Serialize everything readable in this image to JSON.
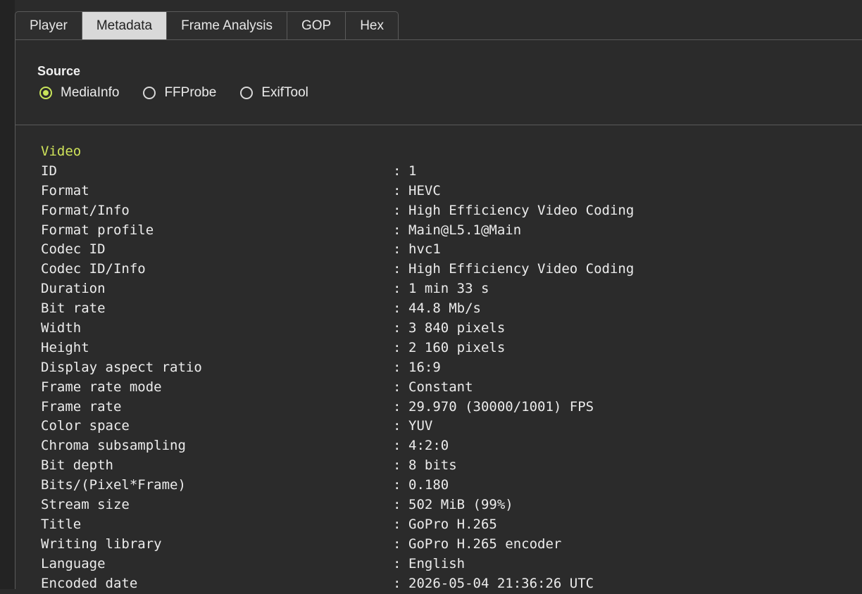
{
  "tabs": [
    {
      "label": "Player",
      "active": false
    },
    {
      "label": "Metadata",
      "active": true
    },
    {
      "label": "Frame Analysis",
      "active": false
    },
    {
      "label": "GOP",
      "active": false
    },
    {
      "label": "Hex",
      "active": false
    }
  ],
  "source": {
    "title": "Source",
    "options": [
      {
        "label": "MediaInfo",
        "checked": true
      },
      {
        "label": "FFProbe",
        "checked": false
      },
      {
        "label": "ExifTool",
        "checked": false
      }
    ]
  },
  "separator": ":",
  "video": {
    "title": "Video",
    "rows": [
      {
        "key": "ID",
        "value": "1"
      },
      {
        "key": "Format",
        "value": "HEVC"
      },
      {
        "key": "Format/Info",
        "value": "High Efficiency Video Coding"
      },
      {
        "key": "Format profile",
        "value": "Main@L5.1@Main"
      },
      {
        "key": "Codec ID",
        "value": "hvc1"
      },
      {
        "key": "Codec ID/Info",
        "value": "High Efficiency Video Coding"
      },
      {
        "key": "Duration",
        "value": "1 min 33 s"
      },
      {
        "key": "Bit rate",
        "value": "44.8 Mb/s"
      },
      {
        "key": "Width",
        "value": "3 840 pixels"
      },
      {
        "key": "Height",
        "value": "2 160 pixels"
      },
      {
        "key": "Display aspect ratio",
        "value": "16:9"
      },
      {
        "key": "Frame rate mode",
        "value": "Constant"
      },
      {
        "key": "Frame rate",
        "value": "29.970 (30000/1001) FPS"
      },
      {
        "key": "Color space",
        "value": "YUV"
      },
      {
        "key": "Chroma subsampling",
        "value": "4:2:0"
      },
      {
        "key": "Bit depth",
        "value": "8 bits"
      },
      {
        "key": "Bits/(Pixel*Frame)",
        "value": "0.180"
      },
      {
        "key": "Stream size",
        "value": "502 MiB (99%)"
      },
      {
        "key": "Title",
        "value": "GoPro H.265"
      },
      {
        "key": "Writing library",
        "value": "GoPro H.265 encoder"
      },
      {
        "key": "Language",
        "value": "English"
      },
      {
        "key": "Encoded date",
        "value": "2026-05-04 21:36:26 UTC"
      }
    ]
  },
  "colors": {
    "accent": "#c8e45a",
    "section_title": "#cfe35a",
    "background": "#2b2b2b",
    "active_tab": "#d9d9d9"
  }
}
